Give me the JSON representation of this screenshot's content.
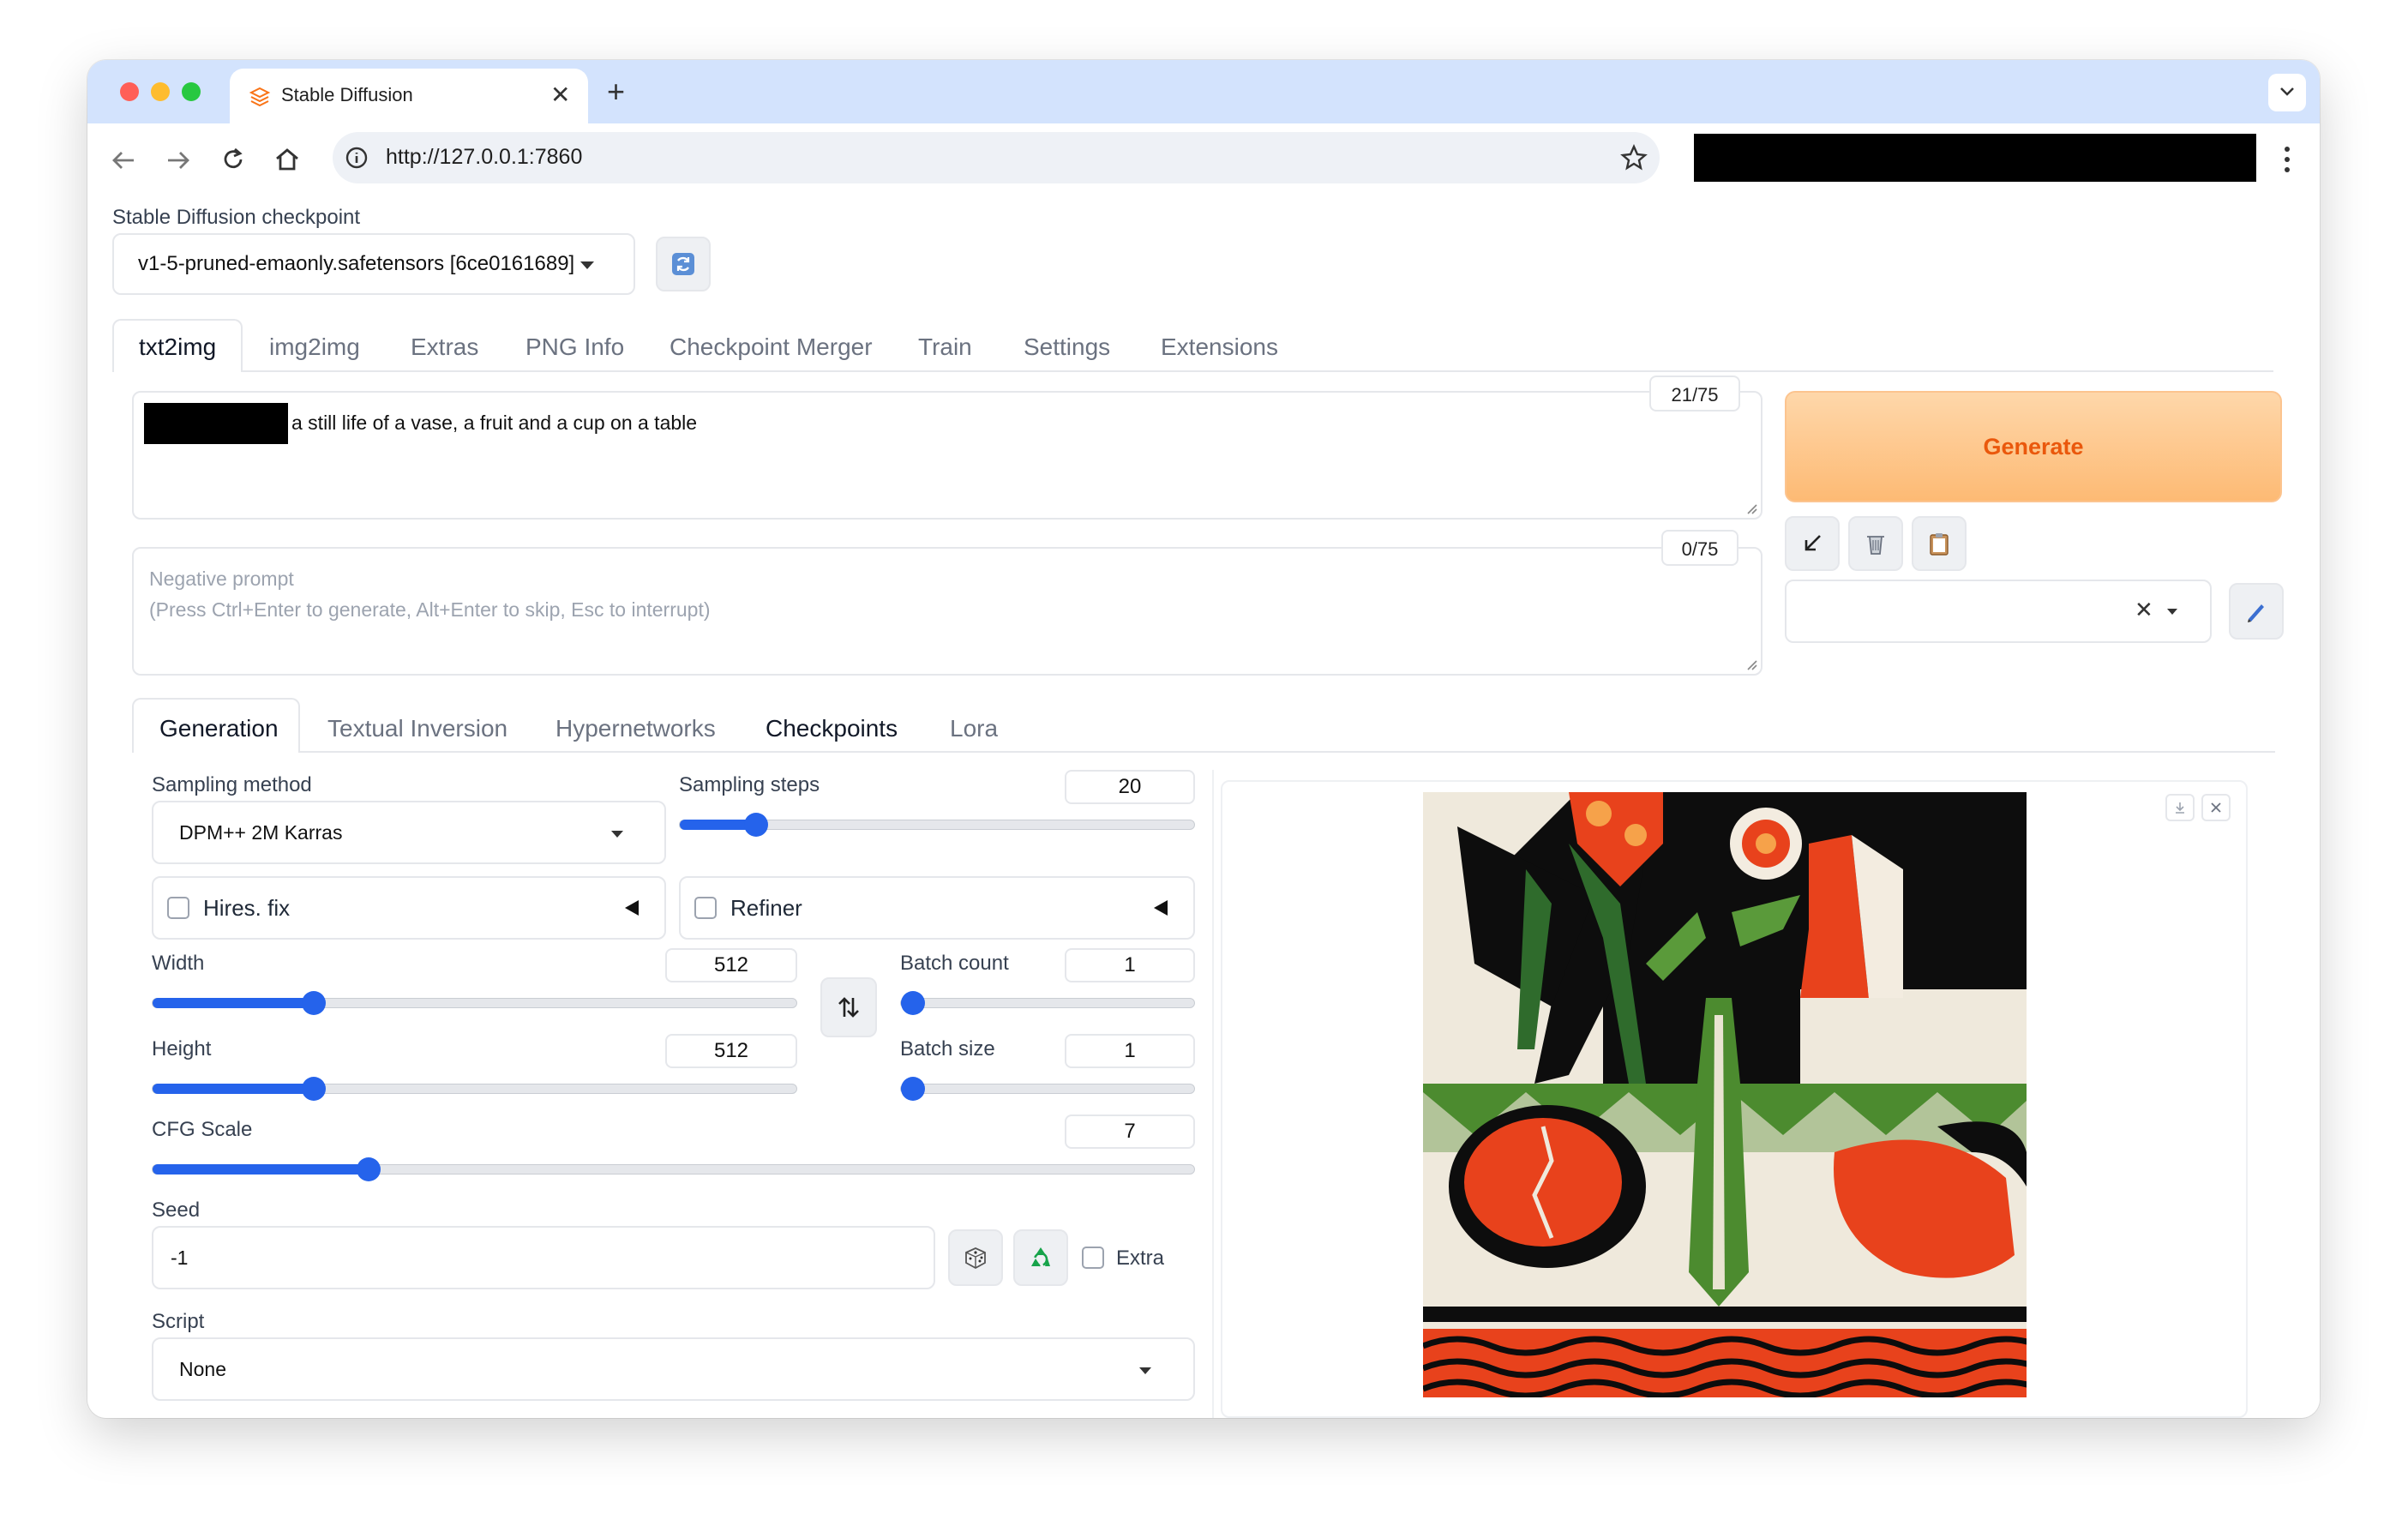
{
  "browser": {
    "tab_title": "Stable Diffusion",
    "url": "http://127.0.0.1:7860"
  },
  "checkpoint": {
    "label": "Stable Diffusion checkpoint",
    "value": "v1-5-pruned-emaonly.safetensors [6ce0161689]"
  },
  "main_tabs": [
    "txt2img",
    "img2img",
    "Extras",
    "PNG Info",
    "Checkpoint Merger",
    "Train",
    "Settings",
    "Extensions"
  ],
  "prompt": {
    "text": "a still life of a vase, a fruit and a cup on a table",
    "token_count": "21/75"
  },
  "negative_prompt": {
    "placeholder_line1": "Negative prompt",
    "placeholder_line2": "(Press Ctrl+Enter to generate, Alt+Enter to skip, Esc to interrupt)",
    "token_count": "0/75"
  },
  "generate_label": "Generate",
  "sub_tabs": [
    "Generation",
    "Textual Inversion",
    "Hypernetworks",
    "Checkpoints",
    "Lora"
  ],
  "params": {
    "sampling_method_label": "Sampling method",
    "sampling_method_value": "DPM++ 2M Karras",
    "sampling_steps_label": "Sampling steps",
    "sampling_steps_value": "20",
    "sampling_steps_fraction": 0.13,
    "hires_label": "Hires. fix",
    "refiner_label": "Refiner",
    "width_label": "Width",
    "width_value": "512",
    "width_fraction": 0.24,
    "height_label": "Height",
    "height_value": "512",
    "height_fraction": 0.24,
    "batch_count_label": "Batch count",
    "batch_count_value": "1",
    "batch_count_fraction": 0.0,
    "batch_size_label": "Batch size",
    "batch_size_value": "1",
    "batch_size_fraction": 0.0,
    "cfg_label": "CFG Scale",
    "cfg_value": "7",
    "cfg_fraction": 0.2,
    "seed_label": "Seed",
    "seed_value": "-1",
    "extra_label": "Extra",
    "script_label": "Script",
    "script_value": "None"
  },
  "colors": {
    "accent": "#2563eb",
    "generate_text": "#ea580c",
    "generate_bg_from": "#fed7aa",
    "generate_bg_to": "#fdba74"
  }
}
